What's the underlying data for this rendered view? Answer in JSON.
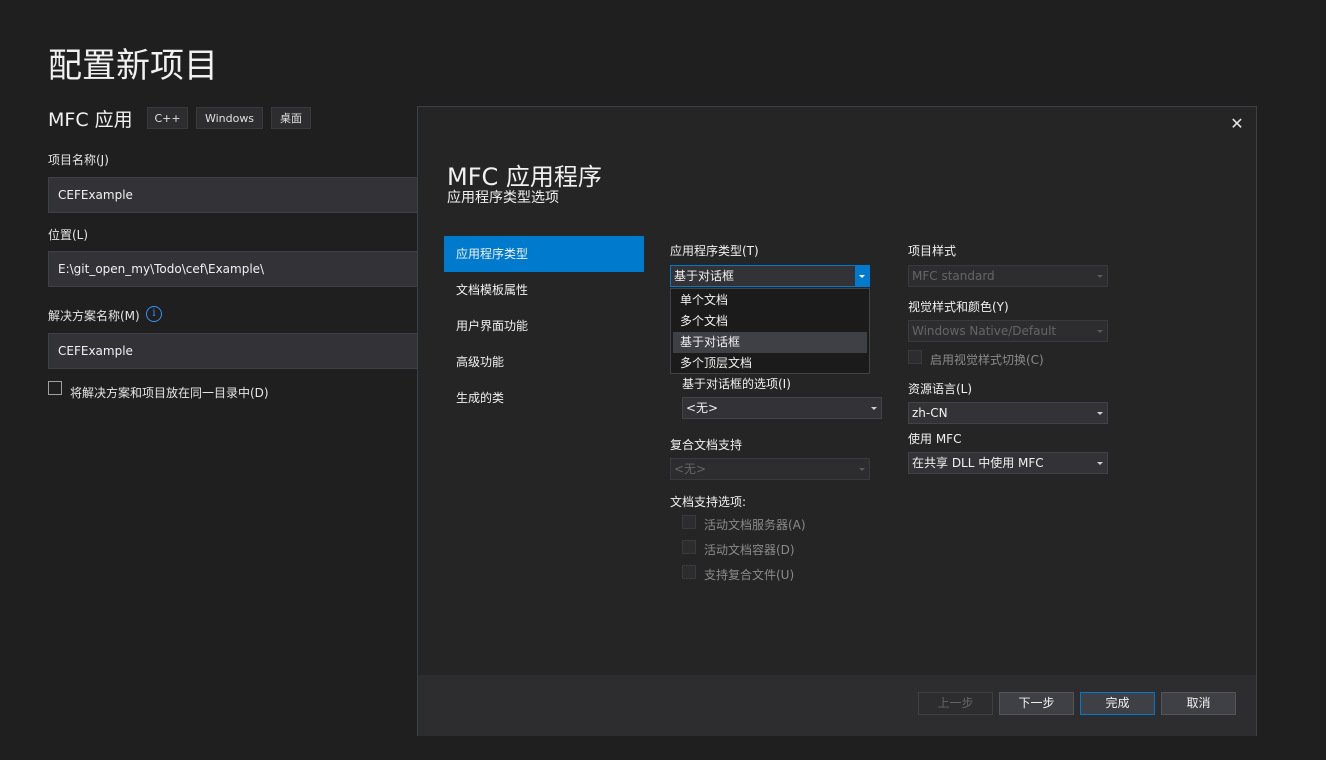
{
  "page": {
    "title": "配置新项目",
    "template_name": "MFC 应用",
    "tags": [
      "C++",
      "Windows",
      "桌面"
    ],
    "project_name_label": "项目名称(J)",
    "project_name_value": "CEFExample",
    "location_label": "位置(L)",
    "location_value": "E:\\git_open_my\\Todo\\cef\\Example\\",
    "solution_name_label": "解决方案名称(M)",
    "info_glyph": "i",
    "solution_name_value": "CEFExample",
    "same_dir_label": "将解决方案和项目放在同一目录中(D)",
    "same_dir_checked": false
  },
  "dialog": {
    "close_glyph": "✕",
    "title": "MFC 应用程序",
    "subtitle": "应用程序类型选项",
    "nav": [
      {
        "label": "应用程序类型",
        "active": true
      },
      {
        "label": "文档模板属性",
        "active": false
      },
      {
        "label": "用户界面功能",
        "active": false
      },
      {
        "label": "高级功能",
        "active": false
      },
      {
        "label": "生成的类",
        "active": false
      }
    ],
    "app_type": {
      "label": "应用程序类型(T)",
      "value": "基于对话框",
      "options": [
        "单个文档",
        "多个文档",
        "基于对话框",
        "多个顶层文档"
      ],
      "selected_index": 2
    },
    "dialog_options": {
      "label": "基于对话框的选项(I)",
      "value": "<无>"
    },
    "compound_doc": {
      "label": "复合文档支持",
      "value": "<无>",
      "disabled": true
    },
    "doc_support": {
      "label": "文档支持选项:",
      "options": [
        "活动文档服务器(A)",
        "活动文档容器(D)",
        "支持复合文件(U)"
      ]
    },
    "project_style": {
      "label": "项目样式",
      "value": "MFC standard",
      "disabled": true
    },
    "visual_style": {
      "label": "视觉样式和颜色(Y)",
      "value": "Windows Native/Default",
      "disabled": true
    },
    "enable_visual_switch": {
      "label": "启用视觉样式切换(C)",
      "disabled": true
    },
    "resource_lang": {
      "label": "资源语言(L)",
      "value": "zh-CN"
    },
    "use_mfc": {
      "label": "使用 MFC",
      "value": "在共享 DLL 中使用 MFC"
    },
    "buttons": {
      "prev": "上一步",
      "next": "下一步",
      "finish": "完成",
      "cancel": "取消"
    }
  },
  "colors": {
    "accent": "#007acc",
    "background": "#1f1f1f",
    "dialog": "#252526"
  }
}
